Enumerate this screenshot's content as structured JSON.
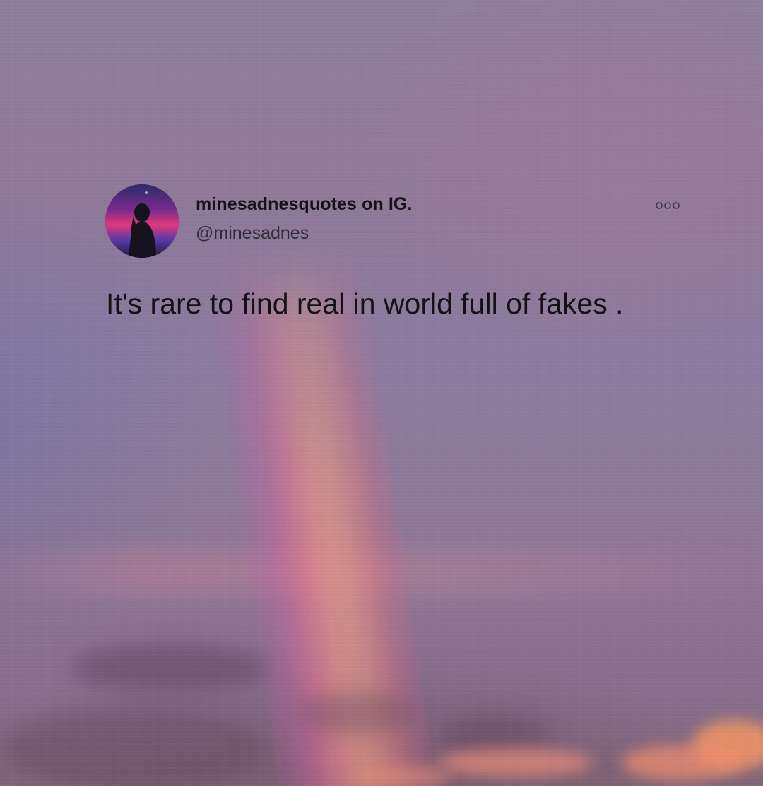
{
  "post": {
    "display_name": "minesadnesquotes on IG.",
    "handle": "@minesadnes",
    "text": "It's rare to find real in world full of fakes ."
  },
  "icons": {
    "avatar": "profile-avatar",
    "more": "more-options-icon"
  },
  "colors": {
    "text": "#141418",
    "handle": "#2e2c36",
    "avatar_accent": "#e0387a"
  }
}
